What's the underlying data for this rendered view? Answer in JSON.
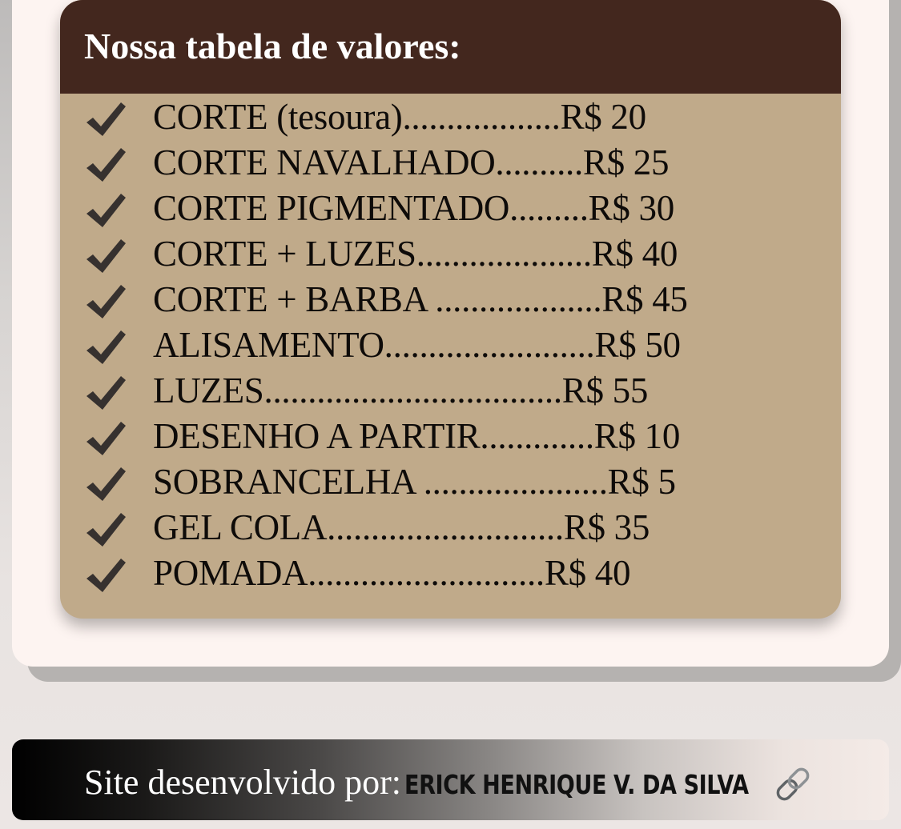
{
  "price_table": {
    "title": "Nossa tabela de valores:",
    "items": [
      {
        "label": "CORTE (tesoura)..................R$ 20"
      },
      {
        "label": "CORTE NAVALHADO..........R$ 25"
      },
      {
        "label": "CORTE PIGMENTADO.........R$ 30"
      },
      {
        "label": "CORTE + LUZES....................R$ 40"
      },
      {
        "label": "CORTE + BARBA ...................R$ 45"
      },
      {
        "label": "ALISAMENTO........................R$ 50"
      },
      {
        "label": "LUZES..................................R$ 55"
      },
      {
        "label": "DESENHO A PARTIR.............R$ 10"
      },
      {
        "label": "SOBRANCELHA .....................R$ 5"
      },
      {
        "label": "GEL COLA...........................R$ 35"
      },
      {
        "label": "POMADA...........................R$ 40"
      }
    ],
    "item_icon": "checkmark-icon"
  },
  "footer": {
    "prefix": "Site desenvolvido por:",
    "author": "ERICK HENRIQUE V. DA SILVA",
    "icon": "link-icon"
  },
  "colors": {
    "header_bg": "#43271e",
    "table_bg": "#c0aa8a",
    "card_bg": "#fdf4f1",
    "check": "#36312f"
  }
}
